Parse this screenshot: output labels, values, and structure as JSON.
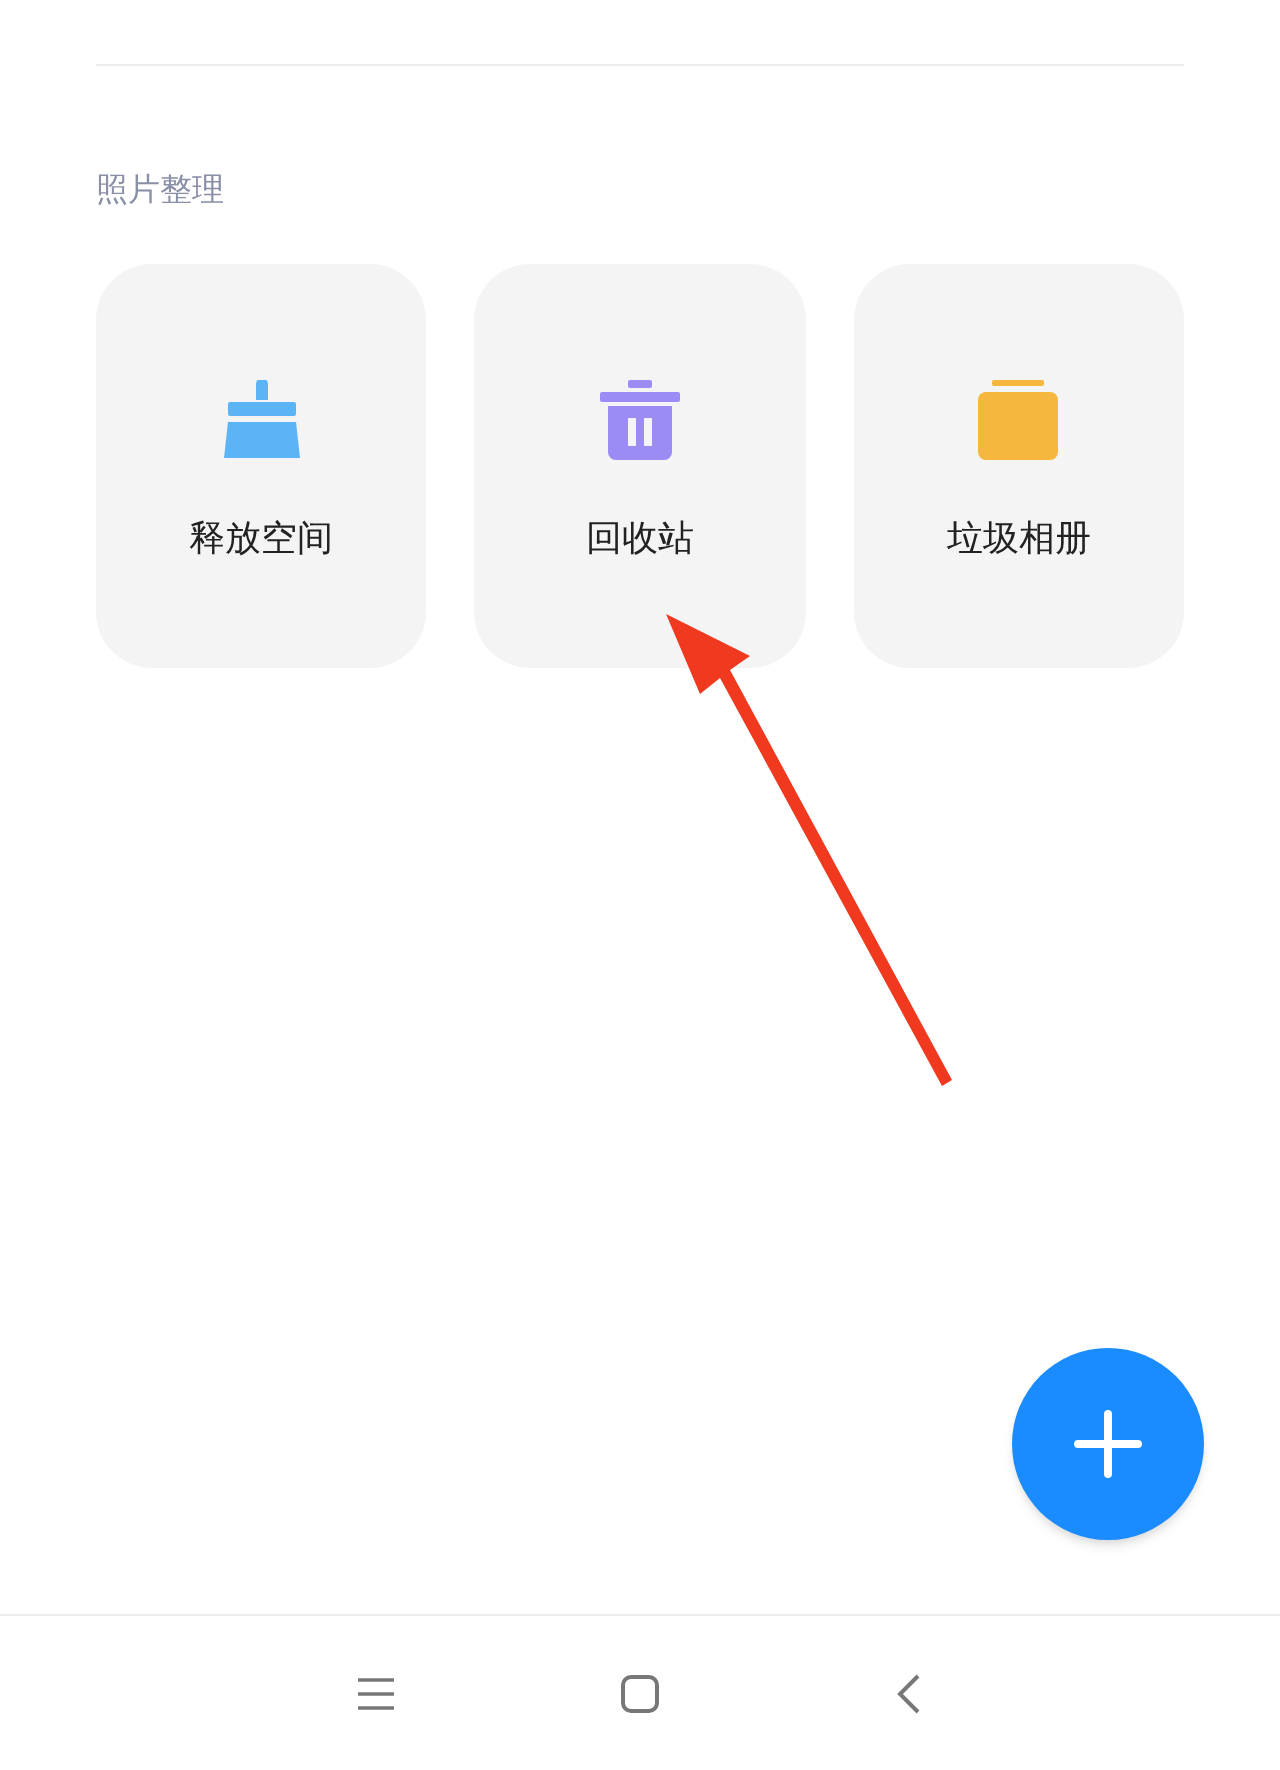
{
  "section": {
    "title": "照片整理"
  },
  "tiles": [
    {
      "kind": "broom",
      "label": "释放空间"
    },
    {
      "kind": "trash",
      "label": "回收站"
    },
    {
      "kind": "folder",
      "label": "垃圾相册"
    }
  ],
  "annotation": {
    "kind": "arrow"
  }
}
